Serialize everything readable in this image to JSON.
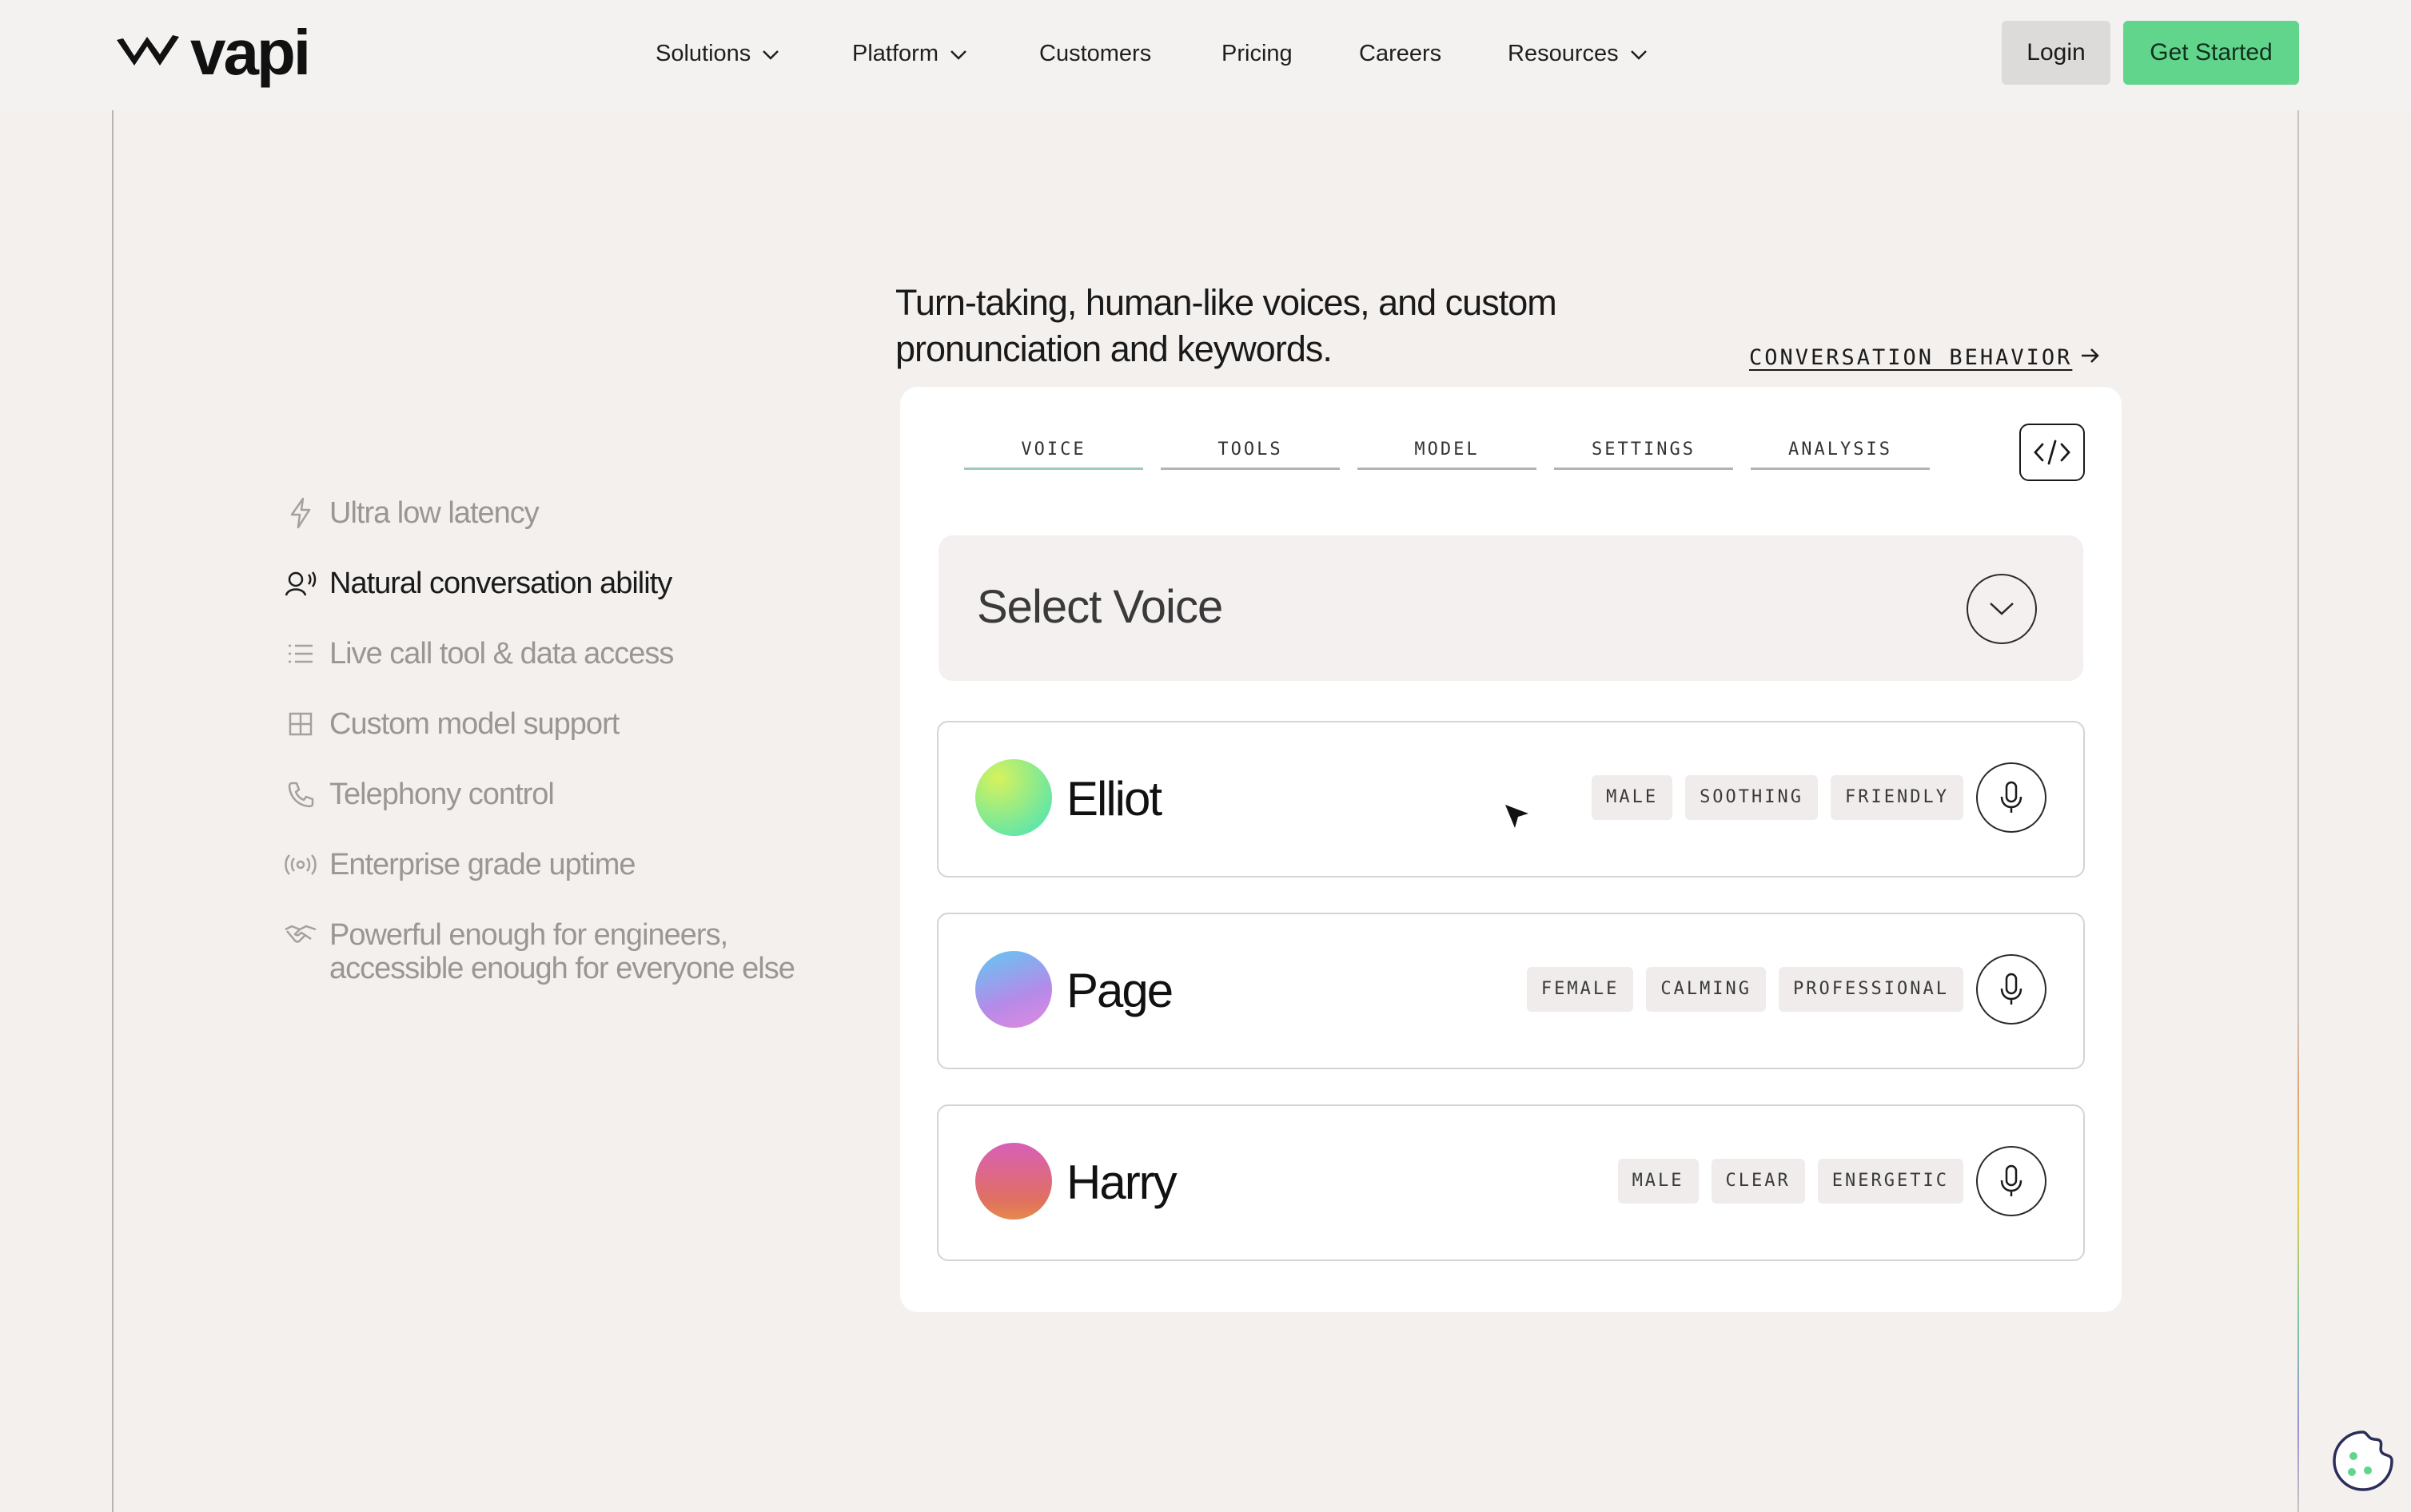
{
  "header": {
    "logo_text": "vapi",
    "nav": [
      {
        "label": "Solutions",
        "dropdown": true
      },
      {
        "label": "Platform",
        "dropdown": true
      },
      {
        "label": "Customers",
        "dropdown": false
      },
      {
        "label": "Pricing",
        "dropdown": false
      },
      {
        "label": "Careers",
        "dropdown": false
      },
      {
        "label": "Resources",
        "dropdown": true
      }
    ],
    "login_label": "Login",
    "get_started_label": "Get Started"
  },
  "features": [
    {
      "label": "Ultra low latency",
      "icon": "lightning-icon",
      "active": false
    },
    {
      "label": "Natural conversation ability",
      "icon": "speaking-person-icon",
      "active": true
    },
    {
      "label": "Live call tool & data access",
      "icon": "list-icon",
      "active": false
    },
    {
      "label": "Custom model support",
      "icon": "grid-icon",
      "active": false
    },
    {
      "label": "Telephony control",
      "icon": "phone-icon",
      "active": false
    },
    {
      "label": "Enterprise grade uptime",
      "icon": "broadcast-icon",
      "active": false
    },
    {
      "label": "Powerful enough for engineers, accessible enough for everyone else",
      "label_line1": "Powerful enough for engineers,",
      "label_line2": "accessible enough for everyone else",
      "icon": "handshake-icon",
      "active": false
    }
  ],
  "section": {
    "heading_line1": "Turn-taking, human-like voices, and custom",
    "heading_line2": "pronunciation and keywords.",
    "link_label": "CONVERSATION BEHAVIOR"
  },
  "card": {
    "tabs": [
      "VOICE",
      "TOOLS",
      "MODEL",
      "SETTINGS",
      "ANALYSIS"
    ],
    "active_tab": "VOICE",
    "select_label": "Select Voice",
    "voices": [
      {
        "name": "Elliot",
        "tags": [
          "MALE",
          "SOOTHING",
          "FRIENDLY"
        ],
        "gradient": [
          "#c6f05a",
          "#5fe6a8"
        ]
      },
      {
        "name": "Page",
        "tags": [
          "FEMALE",
          "CALMING",
          "PROFESSIONAL"
        ],
        "gradient": [
          "#79b6f2",
          "#d98ae6"
        ]
      },
      {
        "name": "Harry",
        "tags": [
          "MALE",
          "CLEAR",
          "ENERGETIC"
        ],
        "gradient": [
          "#dc5fae",
          "#e6784a"
        ]
      }
    ]
  },
  "colors": {
    "accent_green": "#62d58d",
    "active_tab_underline": "#9fc9c1",
    "background": "#f3f0ee"
  }
}
